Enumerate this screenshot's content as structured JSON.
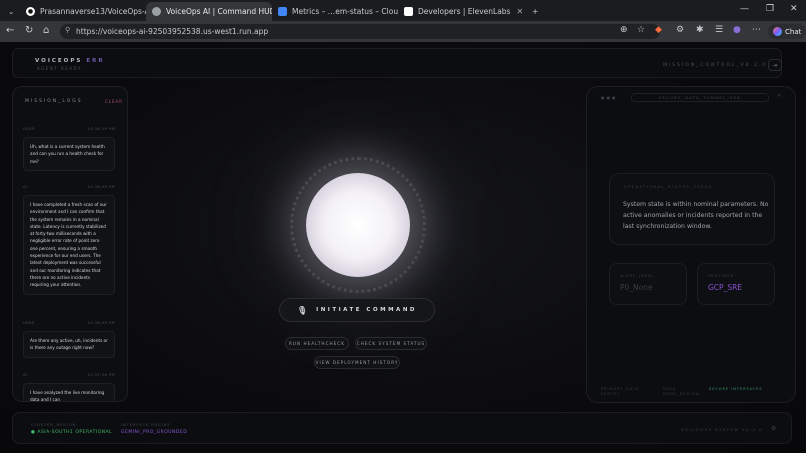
{
  "browser": {
    "tabs": [
      {
        "title": "Prasannaverse13/VoiceOps-AI: Vo",
        "icon": "github-icon",
        "color": "#ffffff"
      },
      {
        "title": "VoiceOps AI | Command HUD",
        "icon": "globe-icon",
        "color": "#9aa0a6"
      },
      {
        "title": "Metrics – …em-status – Cloud Run",
        "icon": "cloud-run-icon",
        "color": "#4285f4"
      },
      {
        "title": "Developers | ElevenLabs",
        "icon": "elevenlabs-icon",
        "color": "#ffffff"
      }
    ],
    "url": "https://voiceops-ai-92503952538.us-west1.run.app",
    "chat_label": "Chat"
  },
  "header": {
    "brand": "VOICEOPS",
    "version": "ERR",
    "subtitle": "AGENT READY",
    "mission_control": "MISSION_CONTROL_V4.2.0",
    "exit_icon": "exit-icon"
  },
  "logs": {
    "title": "MISSION_LOGS",
    "live_label": "CLEAR",
    "entries": [
      {
        "who": "USER",
        "time": "10:36:39 PM",
        "text": "Uh, what is a current system health and can you run a health check for me?"
      },
      {
        "who": "AI",
        "time": "10:36:50 PM",
        "text": "I have completed a fresh scan of our environment and I can confirm that the system remains in a nominal state. Latency is currently stabilized at forty-two milliseconds with a negligible error rate of point zero one percent, ensuring a smooth experience for our end users. The latest deployment was successful and our monitoring indicates that there are no active incidents requiring your attention."
      },
      {
        "who": "USER",
        "time": "10:36:59 PM",
        "text": "Are there any active, uh, incidents or is there any outage right now?"
      },
      {
        "who": "AI",
        "time": "10:37:06 PM",
        "text": "I have analyzed the live monitoring data and I can"
      }
    ]
  },
  "command": {
    "label": "INITIATE COMMAND",
    "mic_icon": "microphone-icon",
    "chips": [
      "RUN HEALTHCHECK",
      "CHECK SYSTEM STATUS",
      "VIEW DEPLOYMENT HISTORY"
    ]
  },
  "right_panel": {
    "header": "SECURE_DATA_TUNNEL_V08",
    "status_label": "OPERATIONAL_STATUS_CLEAR",
    "status_text": "System state is within nominal parameters. No active anomalies or incidents reported in the last synchronization window.",
    "alert_label": "ALERT_LEVEL",
    "alert_value": "P0_None",
    "provider_label": "PROVIDER",
    "provider_value": "GCP_SRE",
    "foot_left": "PRIMARY_DATA SENTRY",
    "foot_mid": "DATA NODE_REGION",
    "foot_right": "SECURE INTERFACES"
  },
  "footer": {
    "cluster_label": "CLUSTER_REGION",
    "cluster_value": "ASIA-SOUTH1 OPERATIONAL",
    "interface_label": "INTERFACE ENGINE",
    "interface_value": "GEMINI_PRO_GROUNDED",
    "right_text": "VOICEOPS SYSTEM V4.2.0"
  }
}
